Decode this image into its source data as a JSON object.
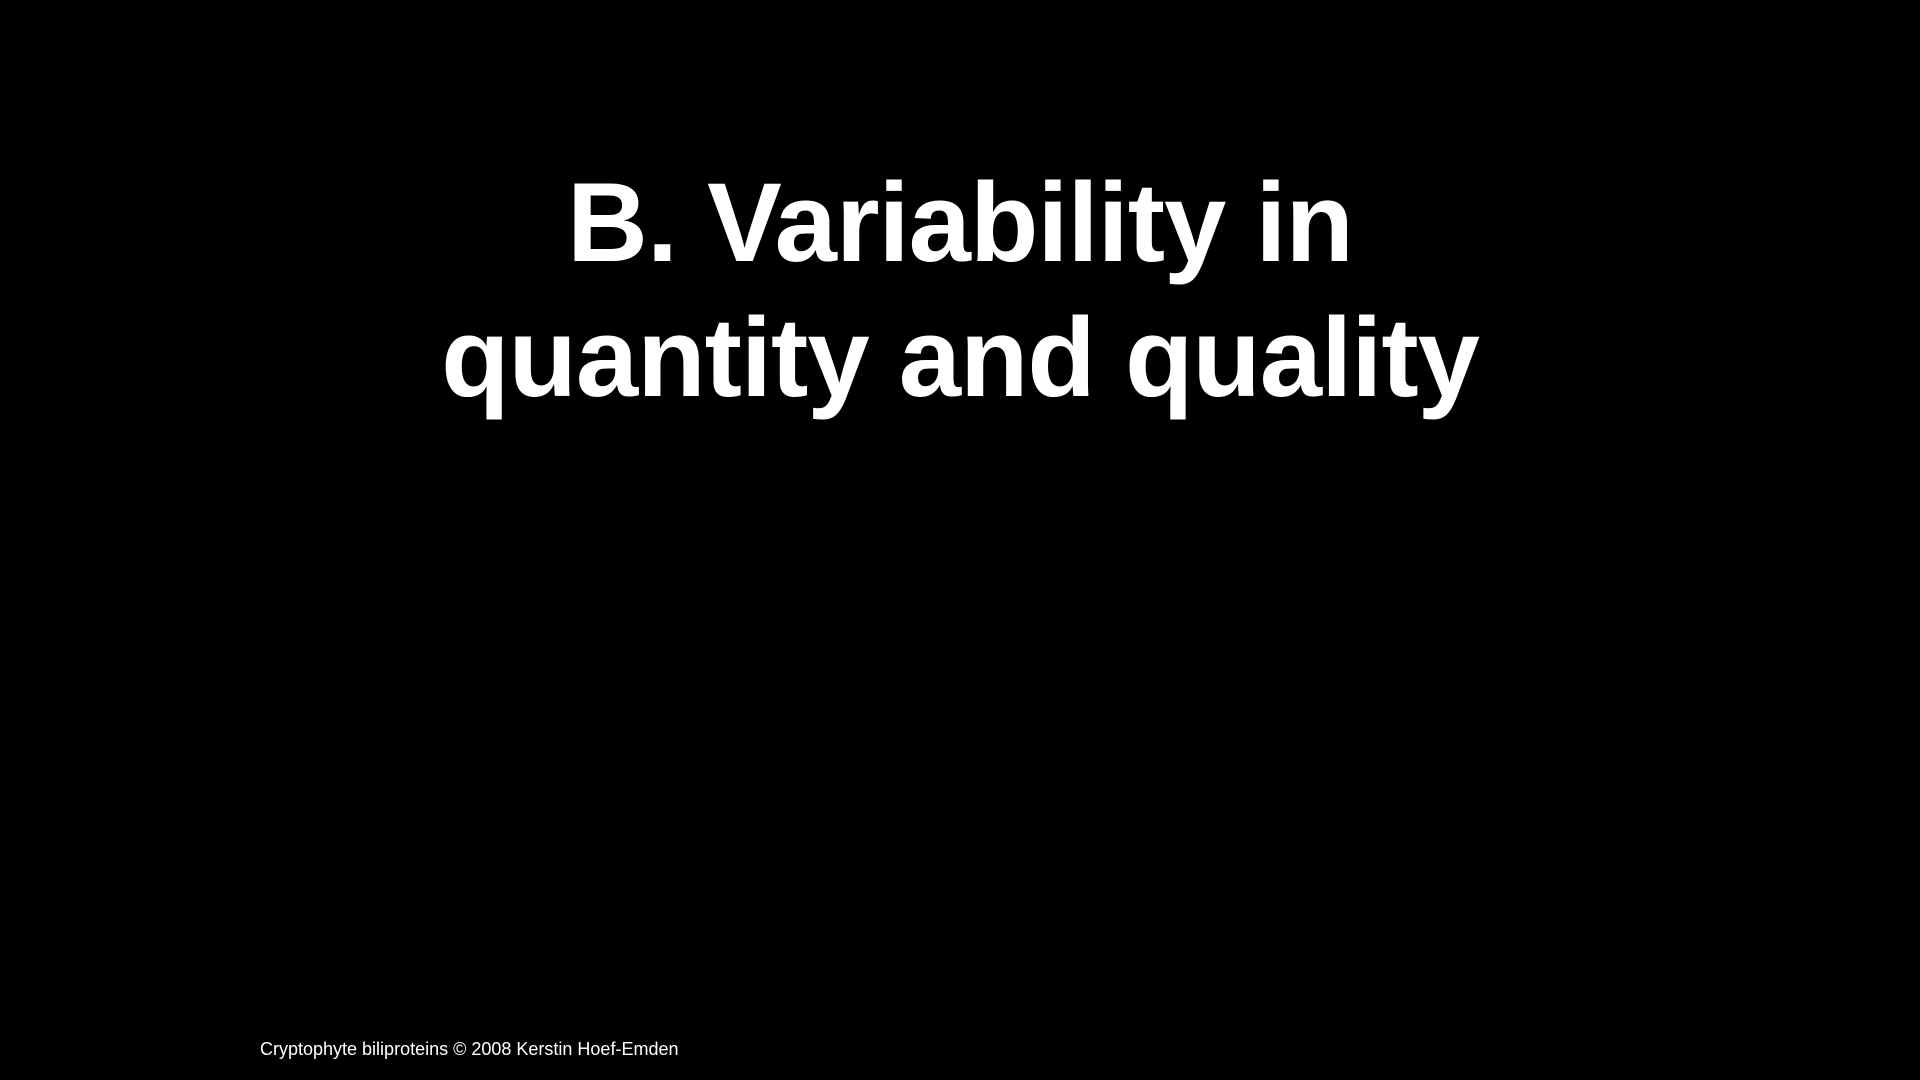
{
  "slide": {
    "title_lines": [
      "B. Variability in",
      "quantity and quality"
    ],
    "footer": "Cryptophyte biliproteins © 2008 Kerstin Hoef-Emden"
  },
  "colors": {
    "background": "#000000",
    "text": "#ffffff"
  }
}
